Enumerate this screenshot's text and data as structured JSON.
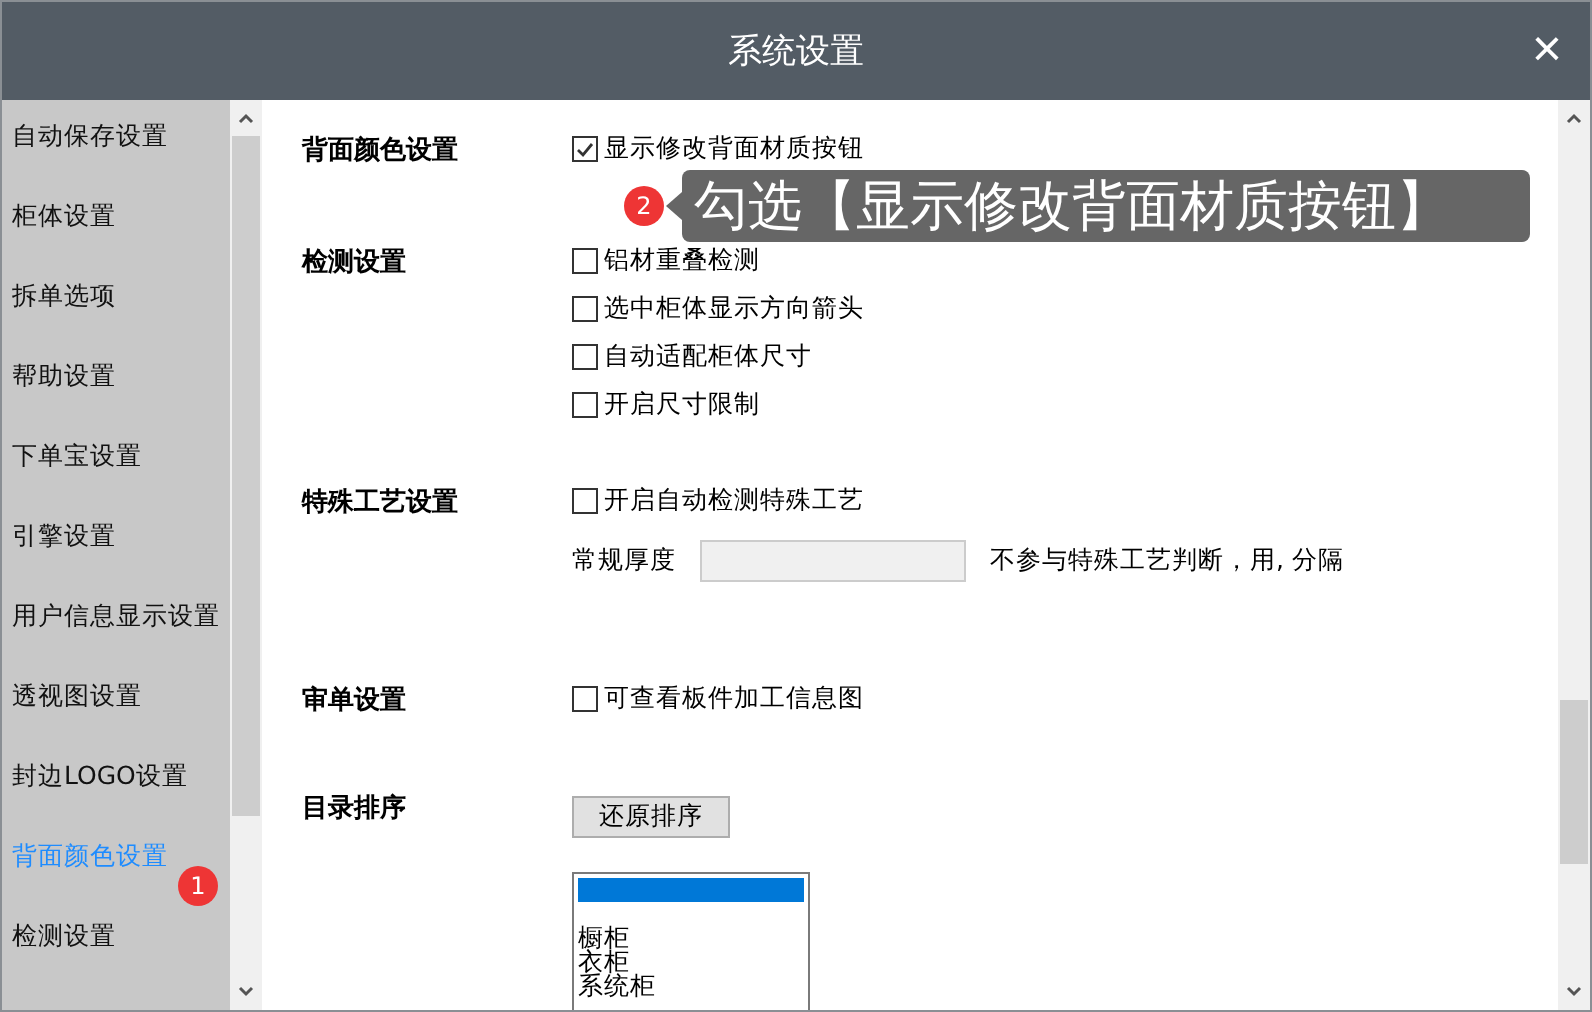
{
  "window": {
    "title": "系统设置",
    "close": "×"
  },
  "sidebar": {
    "items": [
      {
        "label": "自动保存设置",
        "selected": false
      },
      {
        "label": "柜体设置",
        "selected": false
      },
      {
        "label": "拆单选项",
        "selected": false
      },
      {
        "label": "帮助设置",
        "selected": false
      },
      {
        "label": "下单宝设置",
        "selected": false
      },
      {
        "label": "引擎设置",
        "selected": false
      },
      {
        "label": "用户信息显示设置",
        "selected": false
      },
      {
        "label": "透视图设置",
        "selected": false
      },
      {
        "label": "封边LOGO设置",
        "selected": false
      },
      {
        "label": "背面颜色设置",
        "selected": true
      },
      {
        "label": "检测设置",
        "selected": false
      }
    ]
  },
  "sections": [
    {
      "title": "背面颜色设置",
      "options": [
        {
          "label": "显示修改背面材质按钮",
          "checked": true
        }
      ]
    },
    {
      "title": "检测设置",
      "options": [
        {
          "label": "铝材重叠检测",
          "checked": false
        },
        {
          "label": "选中柜体显示方向箭头",
          "checked": false
        },
        {
          "label": "自动适配柜体尺寸",
          "checked": false
        },
        {
          "label": "开启尺寸限制",
          "checked": false
        }
      ]
    },
    {
      "title": "特殊工艺设置",
      "options": [
        {
          "label": "开启自动检测特殊工艺",
          "checked": false
        }
      ],
      "field": {
        "label": "常规厚度",
        "hint": "不参与特殊工艺判断，用, 分隔"
      }
    },
    {
      "title": "审单设置",
      "options": [
        {
          "label": "可查看板件加工信息图",
          "checked": false
        }
      ]
    },
    {
      "title": "目录排序",
      "button": "还原排序",
      "listbox": {
        "top_row_selected": true,
        "items": [
          "橱柜",
          "衣柜",
          "系统柜"
        ]
      }
    }
  ],
  "annotations": [
    {
      "number": "1"
    },
    {
      "number": "2",
      "text": "勾选【显示修改背面材质按钮】"
    }
  ]
}
